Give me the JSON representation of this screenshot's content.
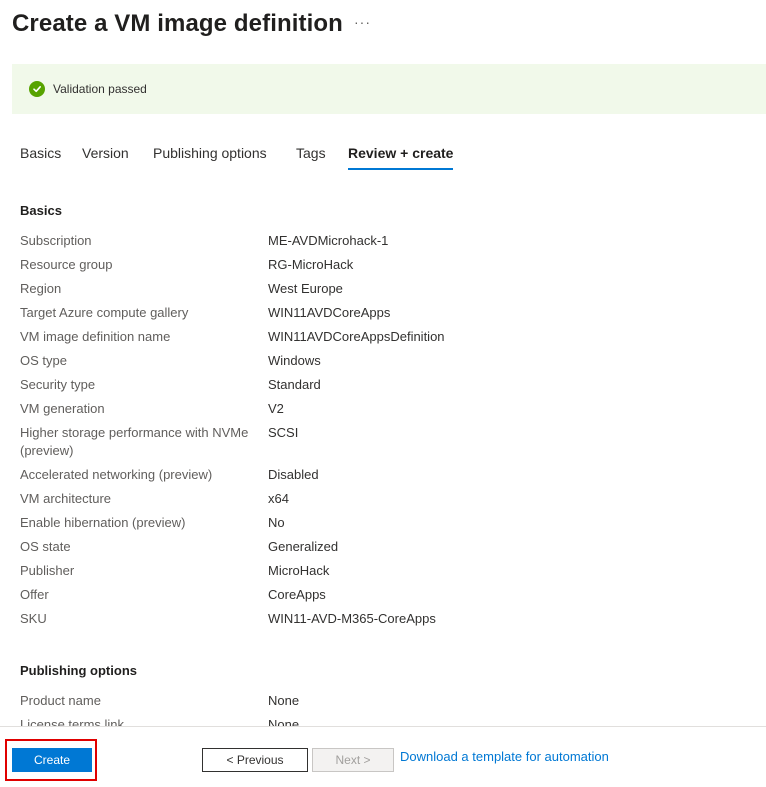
{
  "header": {
    "title": "Create a VM image definition",
    "more_label": "···"
  },
  "validation": {
    "icon": "check-circle-icon",
    "color": "#57a300",
    "background": "#f1f9ea",
    "text": "Validation passed"
  },
  "tabs": [
    {
      "label": "Basics",
      "active": false
    },
    {
      "label": "Version",
      "active": false
    },
    {
      "label": "Publishing options",
      "active": false
    },
    {
      "label": "Tags",
      "active": false
    },
    {
      "label": "Review + create",
      "active": true
    }
  ],
  "basics": {
    "title": "Basics",
    "rows": [
      {
        "label": "Subscription",
        "value": "ME-AVDMicrohack-1"
      },
      {
        "label": "Resource group",
        "value": "RG-MicroHack"
      },
      {
        "label": "Region",
        "value": "West Europe"
      },
      {
        "label": "Target Azure compute gallery",
        "value": "WIN11AVDCoreApps"
      },
      {
        "label": "VM image definition name",
        "value": "WIN11AVDCoreAppsDefinition"
      },
      {
        "label": "OS type",
        "value": "Windows"
      },
      {
        "label": "Security type",
        "value": "Standard"
      },
      {
        "label": "VM generation",
        "value": "V2"
      },
      {
        "label": "Higher storage performance with NVMe (preview)",
        "value": "SCSI"
      },
      {
        "label": "Accelerated networking (preview)",
        "value": "Disabled"
      },
      {
        "label": "VM architecture",
        "value": "x64"
      },
      {
        "label": "Enable hibernation (preview)",
        "value": "No"
      },
      {
        "label": "OS state",
        "value": "Generalized"
      },
      {
        "label": "Publisher",
        "value": "MicroHack"
      },
      {
        "label": "Offer",
        "value": "CoreApps"
      },
      {
        "label": "SKU",
        "value": "WIN11-AVD-M365-CoreApps"
      }
    ]
  },
  "publishing": {
    "title": "Publishing options",
    "rows": [
      {
        "label": "Product name",
        "value": "None"
      },
      {
        "label": "License terms link",
        "value": "None"
      }
    ]
  },
  "footer": {
    "create_label": "Create",
    "previous_label": "< Previous",
    "next_label": "Next >",
    "template_link": "Download a template for automation",
    "accent": "#0078d4",
    "highlight_color": "#e00000"
  }
}
